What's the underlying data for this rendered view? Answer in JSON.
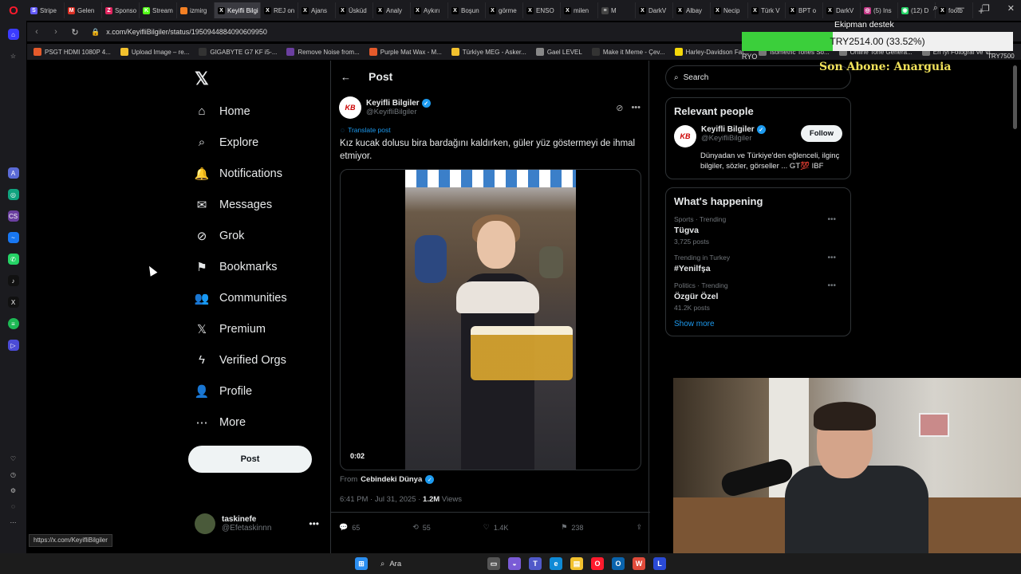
{
  "browser": {
    "tabs": [
      {
        "label": "Stripe",
        "color": "#635bff",
        "glyph": "S"
      },
      {
        "label": "Gelen",
        "color": "#d93025",
        "glyph": "M"
      },
      {
        "label": "Sponso",
        "color": "#e0245e",
        "glyph": "Z"
      },
      {
        "label": "Stream",
        "color": "#53fc18",
        "glyph": "K"
      },
      {
        "label": "izmirg",
        "color": "#f48024",
        "glyph": ""
      },
      {
        "label": "Keyifli Bilgi",
        "color": "#000000",
        "glyph": "X",
        "active": true
      },
      {
        "label": "REJ on",
        "color": "#000000",
        "glyph": "X"
      },
      {
        "label": "Ajans",
        "color": "#000000",
        "glyph": "X"
      },
      {
        "label": "Üsküd",
        "color": "#000000",
        "glyph": "X"
      },
      {
        "label": "Analy",
        "color": "#000000",
        "glyph": "X"
      },
      {
        "label": "Aykırı",
        "color": "#000000",
        "glyph": "X"
      },
      {
        "label": "Boşun",
        "color": "#000000",
        "glyph": "X"
      },
      {
        "label": "görme",
        "color": "#000000",
        "glyph": "X"
      },
      {
        "label": "ENSO",
        "color": "#000000",
        "glyph": "X"
      },
      {
        "label": "milen",
        "color": "#000000",
        "glyph": "X"
      },
      {
        "label": "M",
        "color": "#444444",
        "glyph": "≡"
      },
      {
        "label": "DarkV",
        "color": "#000000",
        "glyph": "X"
      },
      {
        "label": "Albay",
        "color": "#000000",
        "glyph": "X"
      },
      {
        "label": "Necip",
        "color": "#000000",
        "glyph": "X"
      },
      {
        "label": "Türk V",
        "color": "#000000",
        "glyph": "X"
      },
      {
        "label": "BPT o",
        "color": "#000000",
        "glyph": "X"
      },
      {
        "label": "DarkV",
        "color": "#000000",
        "glyph": "X"
      },
      {
        "label": "(5) Ins",
        "color": "#c13584",
        "glyph": "◎"
      },
      {
        "label": "(12) D",
        "color": "#25d366",
        "glyph": "◉"
      },
      {
        "label": "footb",
        "color": "#000000",
        "glyph": "X"
      }
    ],
    "url": "x.com/KeyifliBilgiler/status/1950944884090609950",
    "bookmarks": [
      {
        "label": "PSGT HDMI 1080P 4...",
        "color": "#e55a2b"
      },
      {
        "label": "Upload Image – re...",
        "color": "#f2c12e"
      },
      {
        "label": "GIGABYTE G7 KF i5-...",
        "color": "#333333"
      },
      {
        "label": "Remove Noise from...",
        "color": "#6b3fa0"
      },
      {
        "label": "Purple Mat Wax - M...",
        "color": "#e55a2b"
      },
      {
        "label": "Türkiye MEG - Asker...",
        "color": "#f2c12e"
      },
      {
        "label": "Gael LEVEL",
        "color": "#888888"
      },
      {
        "label": "Make it Meme - Çev...",
        "color": "#333333"
      },
      {
        "label": "Harley-Davidson Fat...",
        "color": "#f5d90a"
      },
      {
        "label": "Isometric Tones So...",
        "color": "#777777"
      },
      {
        "label": "Online Tone Genera...",
        "color": "#777777"
      },
      {
        "label": "En İyi Fotoğraf ve Vi...",
        "color": "#777777"
      }
    ],
    "status_url": "https://x.com/KeyifliBilgiler"
  },
  "nav": {
    "items": [
      {
        "label": "Home",
        "icon": "⌂"
      },
      {
        "label": "Explore",
        "icon": "⌕"
      },
      {
        "label": "Notifications",
        "icon": "🔔"
      },
      {
        "label": "Messages",
        "icon": "✉"
      },
      {
        "label": "Grok",
        "icon": "⊘"
      },
      {
        "label": "Bookmarks",
        "icon": "⚑"
      },
      {
        "label": "Communities",
        "icon": "👥"
      },
      {
        "label": "Premium",
        "icon": "𝕏"
      },
      {
        "label": "Verified Orgs",
        "icon": "ϟ"
      },
      {
        "label": "Profile",
        "icon": "👤"
      },
      {
        "label": "More",
        "icon": "⋯"
      }
    ],
    "post_button": "Post",
    "account": {
      "name": "taskinefe",
      "handle": "@Efetaskinnn"
    }
  },
  "post": {
    "header": "Post",
    "author_name": "Keyifli Bilgiler",
    "author_handle": "@KeyifliBilgiler",
    "avatar_text": "KB",
    "translate": "Translate post",
    "text": "Kız kucak dolusu bira bardağını kaldırken, güler yüz göstermeyi de ihmal etmiyor.",
    "video_time": "0:02",
    "from_label": "From",
    "from_name": "Cebindeki Dünya",
    "time": "6:41 PM · Jul 31, 2025 · ",
    "views_count": "1.2M",
    "views_label": " Views",
    "replies": "65",
    "reposts": "55",
    "likes": "1.4K",
    "bookmarks": "238"
  },
  "sidebar": {
    "search_placeholder": "Search",
    "relevant_title": "Relevant people",
    "person": {
      "name": "Keyifli Bilgiler",
      "handle": "@KeyifliBilgiler",
      "follow": "Follow",
      "bio": "Dünyadan ve Türkiye'den eğlenceli, ilginç bilgiler, sözler, görseller ... GT💯 IBF"
    },
    "happening_title": "What's happening",
    "trends": [
      {
        "context": "Sports · Trending",
        "name": "Tügva",
        "count": "3,725 posts"
      },
      {
        "context": "Trending in Turkey",
        "name": "#Yenilfşa",
        "count": ""
      },
      {
        "context": "Politics · Trending",
        "name": "Özgür Özel",
        "count": "41.2K posts"
      }
    ],
    "show_more": "Show more"
  },
  "overlay": {
    "ekipman": "Ekipman destek",
    "progress_text": "TRY2514.00 (33.52%)",
    "progress_fraction": 0.3352,
    "left_label": "RYO",
    "goal_label": "TRY7500",
    "abone": "Son Abone: Anarguia"
  },
  "taskbar": {
    "search_label": "Ara"
  },
  "colors": {
    "accent": "#1d9bf0",
    "background": "#000000",
    "progress": "#3bcf3b"
  }
}
